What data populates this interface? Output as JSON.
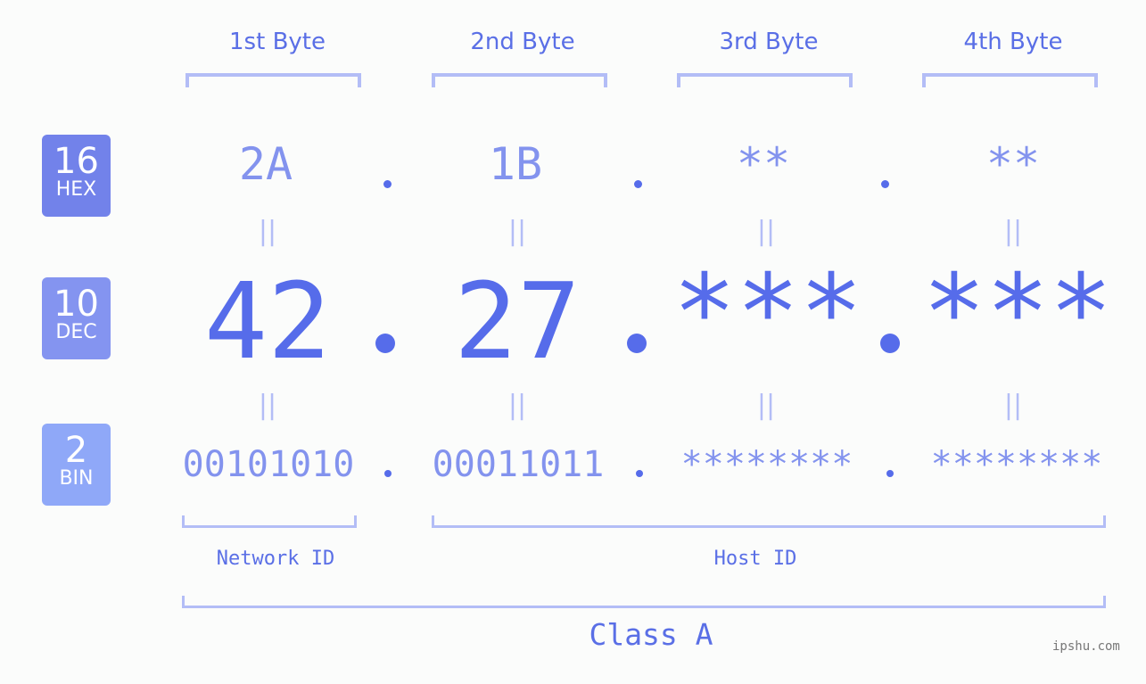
{
  "badges": [
    {
      "number": "16",
      "label": "HEX",
      "color": "#7282ea"
    },
    {
      "number": "10",
      "label": "DEC",
      "color": "#8494f0"
    },
    {
      "number": "2",
      "label": "BIN",
      "color": "#8fa8f8"
    }
  ],
  "byte_headers": [
    "1st Byte",
    "2nd Byte",
    "3rd Byte",
    "4th Byte"
  ],
  "hex": [
    "2A",
    "1B",
    "**",
    "**"
  ],
  "dec": [
    "42",
    "27",
    "***",
    "***"
  ],
  "bin": [
    "00101010",
    "00011011",
    "********",
    "********"
  ],
  "equals_glyph": "||",
  "network_label": "Network ID",
  "host_label": "Host ID",
  "class_label": "Class A",
  "watermark": "ipshu.com",
  "colors": {
    "primary": "#566cea",
    "secondary": "#8393ee",
    "bracket": "#b3bdf6",
    "background": "#fbfcfb"
  }
}
